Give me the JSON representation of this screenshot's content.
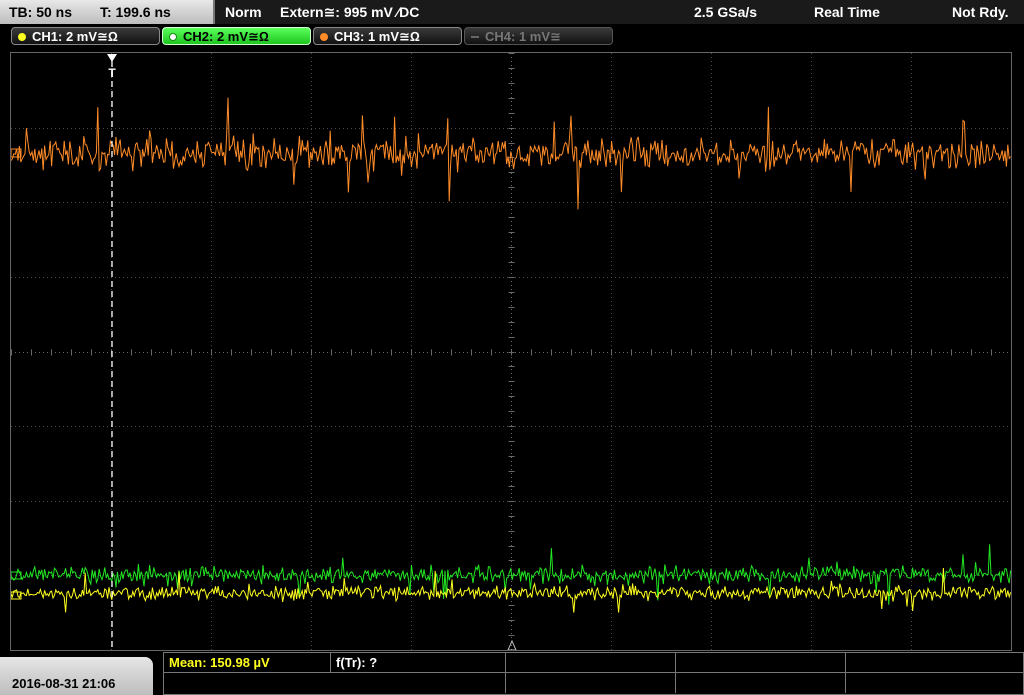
{
  "topbar": {
    "timebase": "TB: 50 ns",
    "trigger_time": "T: 199.6 ns",
    "trigger_mode": "Norm",
    "trigger_source": "Extern≅: 995 mV ∕DC",
    "sample_rate": "2.5 GSa/s",
    "acq_mode": "Real Time",
    "status": "Not Rdy."
  },
  "channels": [
    {
      "label": "CH1: 2 mV≅Ω",
      "color": "#ffff20"
    },
    {
      "label": "CH2: 2 mV≅Ω",
      "color": "#22e622"
    },
    {
      "label": "CH3: 1 mV≅Ω",
      "color": "#ff8c28"
    },
    {
      "label": "CH4: 1 mV≅",
      "color": "#777777"
    }
  ],
  "trigger_marker": "T",
  "datetime": "2016-08-31 21:06",
  "measurements": {
    "mean": "Mean: 150.98 µV",
    "freq": "f(Tr): ?"
  },
  "trace_colors": {
    "ch1": "#ffff20",
    "ch2": "#22e622",
    "ch3": "#ff8c28"
  }
}
